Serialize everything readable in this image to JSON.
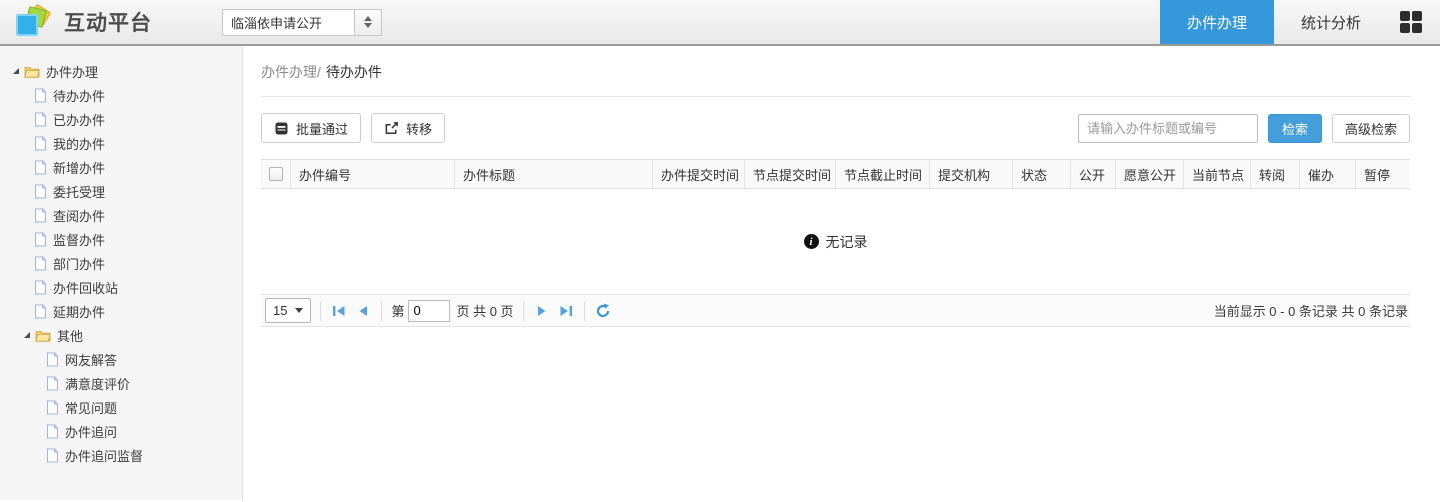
{
  "header": {
    "title": "互动平台",
    "site_select_value": "临淄依申请公开",
    "tabs": [
      {
        "label": "办件办理",
        "active": true
      },
      {
        "label": "统计分析",
        "active": false
      }
    ]
  },
  "sidebar": {
    "groups": [
      {
        "label": "办件办理",
        "items": [
          "待办办件",
          "已办办件",
          "我的办件",
          "新增办件",
          "委托受理",
          "查阅办件",
          "监督办件",
          "部门办件",
          "办件回收站",
          "延期办件"
        ]
      },
      {
        "label": "其他",
        "items": [
          "网友解答",
          "满意度评价",
          "常见问题",
          "办件追问",
          "办件追问监督"
        ]
      }
    ]
  },
  "breadcrumb": {
    "parent": "办件办理/",
    "current": "待办办件"
  },
  "toolbar": {
    "batch_approve": "批量通过",
    "transfer": "转移",
    "search_placeholder": "请输入办件标题或编号",
    "search": "检索",
    "advanced_search": "高级检索"
  },
  "table": {
    "columns": [
      "办件编号",
      "办件标题",
      "办件提交时间",
      "节点提交时间",
      "节点截止时间",
      "提交机构",
      "状态",
      "公开",
      "愿意公开",
      "当前节点",
      "转阅",
      "催办",
      "暂停"
    ],
    "empty": "无记录"
  },
  "pagination": {
    "page_size": "15",
    "page_label_before": "第",
    "page_value": "0",
    "page_label_after": "页 共 0 页",
    "summary": "当前显示 0 - 0 条记录 共 0 条记录"
  },
  "colors": {
    "accent_blue": "#3498db",
    "pager_icon_blue": "#57a2d9",
    "sidebar_bg": "#f5f5f5"
  }
}
